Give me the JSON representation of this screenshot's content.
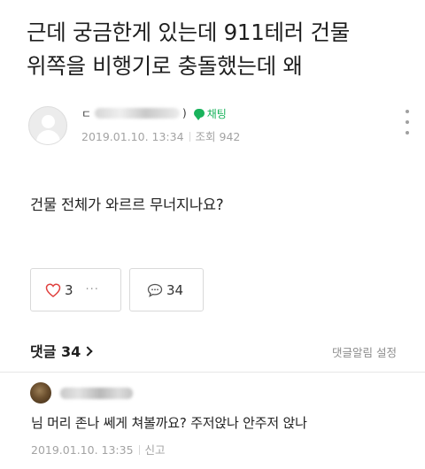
{
  "post": {
    "title_line1": "근데 궁금한게 있는데 911테러 건물",
    "title_line2": "위쪽을 비행기로 충돌했는데 왜",
    "author": {
      "name_prefix": "ㄷ",
      "name_suffix": ")",
      "chat_label": "채팅"
    },
    "date": "2019.01.10. 13:34",
    "views": "조회 942",
    "content": "건물 전체가 와르르 무너지나요?",
    "likes": "3",
    "comments_count": "34",
    "dots": "···"
  },
  "comments_section": {
    "title": "댓글 34",
    "setting": "댓글알림 설정"
  },
  "comments": [
    {
      "text": "님 머리 존나 쎄게 쳐볼까요? 주저앉나 안주저 앉나",
      "date": "2019.01.10. 13:35",
      "report": "신고"
    }
  ],
  "colors": {
    "accent_green": "#19b35c",
    "muted_text": "#a3a3a3"
  },
  "icons": [
    "person-icon",
    "chat-icon",
    "more-vertical-icon",
    "heart-icon",
    "comment-icon",
    "chevron-right-icon"
  ]
}
